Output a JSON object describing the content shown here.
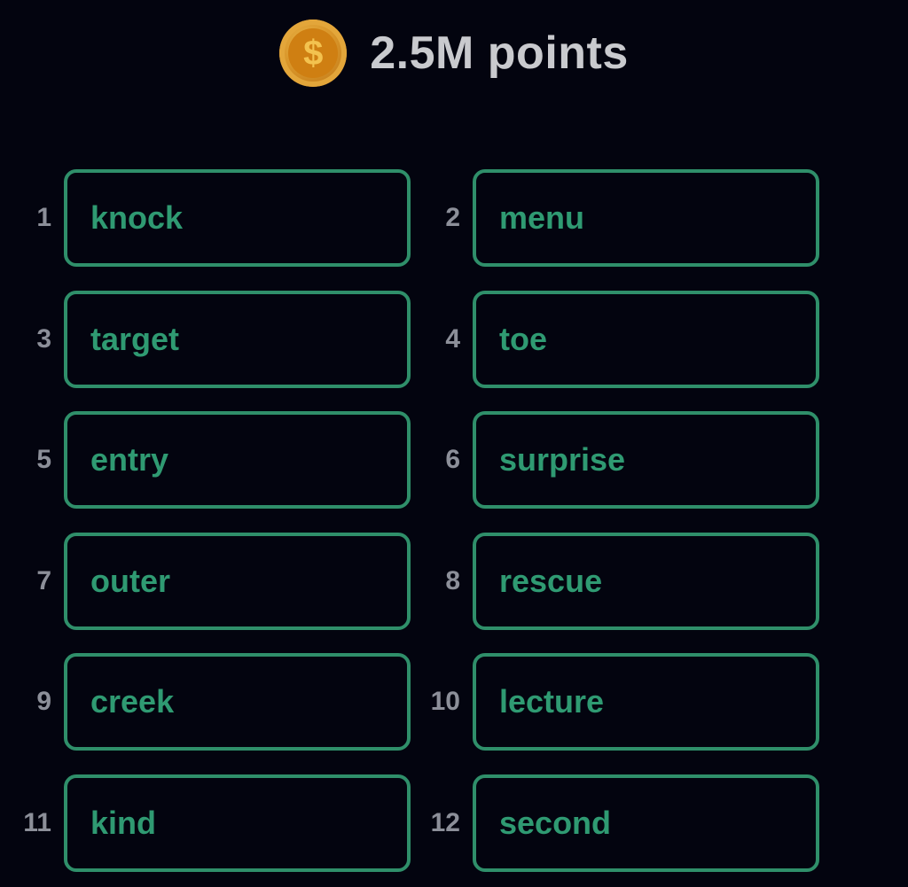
{
  "header": {
    "coin_icon_symbol": "$",
    "points_label": "2.5M points"
  },
  "colors": {
    "background": "#03040f",
    "accent_green": "#2f8f6a",
    "word_text": "#2f9a72",
    "number_text": "#8c8f99",
    "points_text": "#c9cace"
  },
  "words": [
    {
      "number": "1",
      "word": "knock"
    },
    {
      "number": "2",
      "word": "menu"
    },
    {
      "number": "3",
      "word": "target"
    },
    {
      "number": "4",
      "word": "toe"
    },
    {
      "number": "5",
      "word": "entry"
    },
    {
      "number": "6",
      "word": "surprise"
    },
    {
      "number": "7",
      "word": "outer"
    },
    {
      "number": "8",
      "word": "rescue"
    },
    {
      "number": "9",
      "word": "creek"
    },
    {
      "number": "10",
      "word": "lecture"
    },
    {
      "number": "11",
      "word": "kind"
    },
    {
      "number": "12",
      "word": "second"
    }
  ]
}
